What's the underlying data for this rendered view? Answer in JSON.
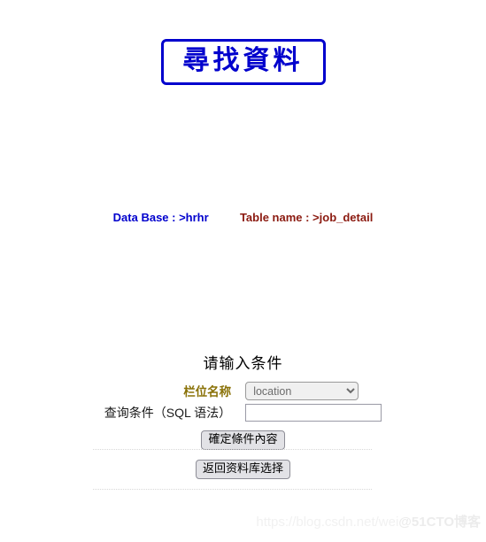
{
  "page": {
    "title": "尋找資料"
  },
  "info": {
    "database_label": "Data Base : >hrhr",
    "table_label": "Table name : >job_detail",
    "database_color": "#0000cd",
    "table_color": "#8b1a10"
  },
  "form": {
    "heading": "请输入条件",
    "field_name_label": "栏位名称",
    "field_name_color": "#8a7208",
    "field_select": {
      "selected": "location",
      "options": [
        "location"
      ]
    },
    "condition_label": "查询条件（SQL 语法）",
    "condition_input": {
      "value": "",
      "placeholder": ""
    },
    "submit_label": "確定條件內容"
  },
  "footer": {
    "return_label": "返回资料库选择"
  },
  "watermark": {
    "url": "https://blog.csdn.net/wei",
    "brand": "@51CTO博客"
  }
}
